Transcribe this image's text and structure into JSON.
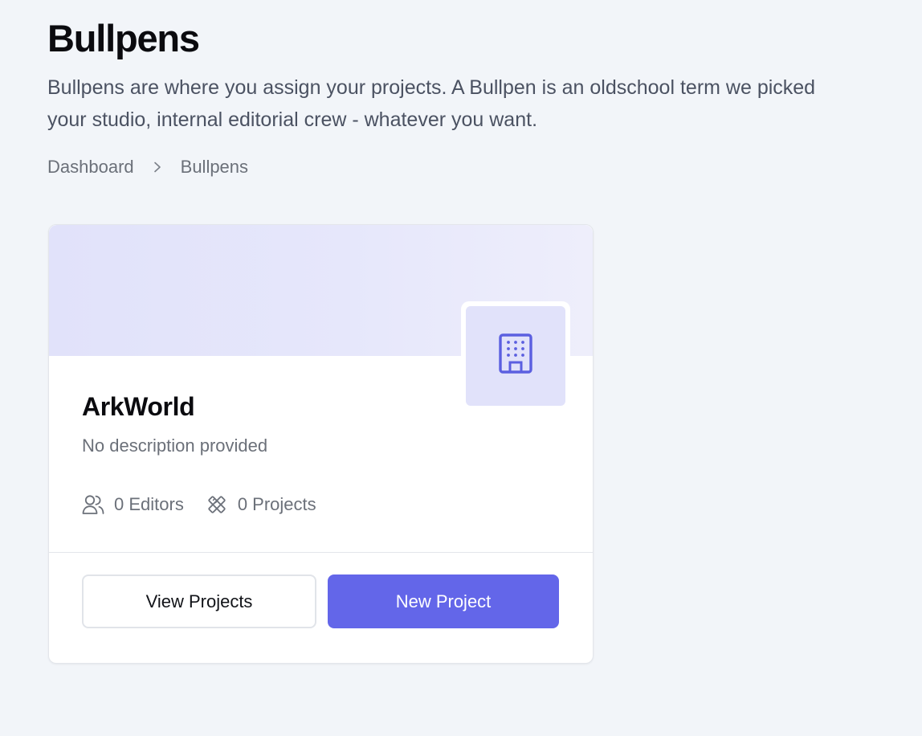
{
  "header": {
    "title": "Bullpens",
    "description": "Bullpens are where you assign your projects. A Bullpen is an oldschool term we picked your studio, internal editorial crew - whatever you want.",
    "description_line1": "Bullpens are where you assign your projects. A Bullpen is an oldschool term we picked",
    "description_line2": "your studio, internal editorial crew - whatever you want."
  },
  "breadcrumb": {
    "items": [
      {
        "label": "Dashboard"
      },
      {
        "label": "Bullpens"
      }
    ],
    "separator_icon": "chevron-right-icon"
  },
  "bullpens": [
    {
      "name": "ArkWorld",
      "description": "No description provided",
      "icon": "building-office-icon",
      "editors_label": "0 Editors",
      "editors_count": 0,
      "projects_label": "0 Projects",
      "projects_count": 0,
      "view_projects_label": "View Projects",
      "new_project_label": "New Project"
    }
  ],
  "colors": {
    "background": "#f2f5f9",
    "accent": "#6366e9",
    "banner": "#e1e2fa",
    "muted_text": "#6b7079"
  }
}
